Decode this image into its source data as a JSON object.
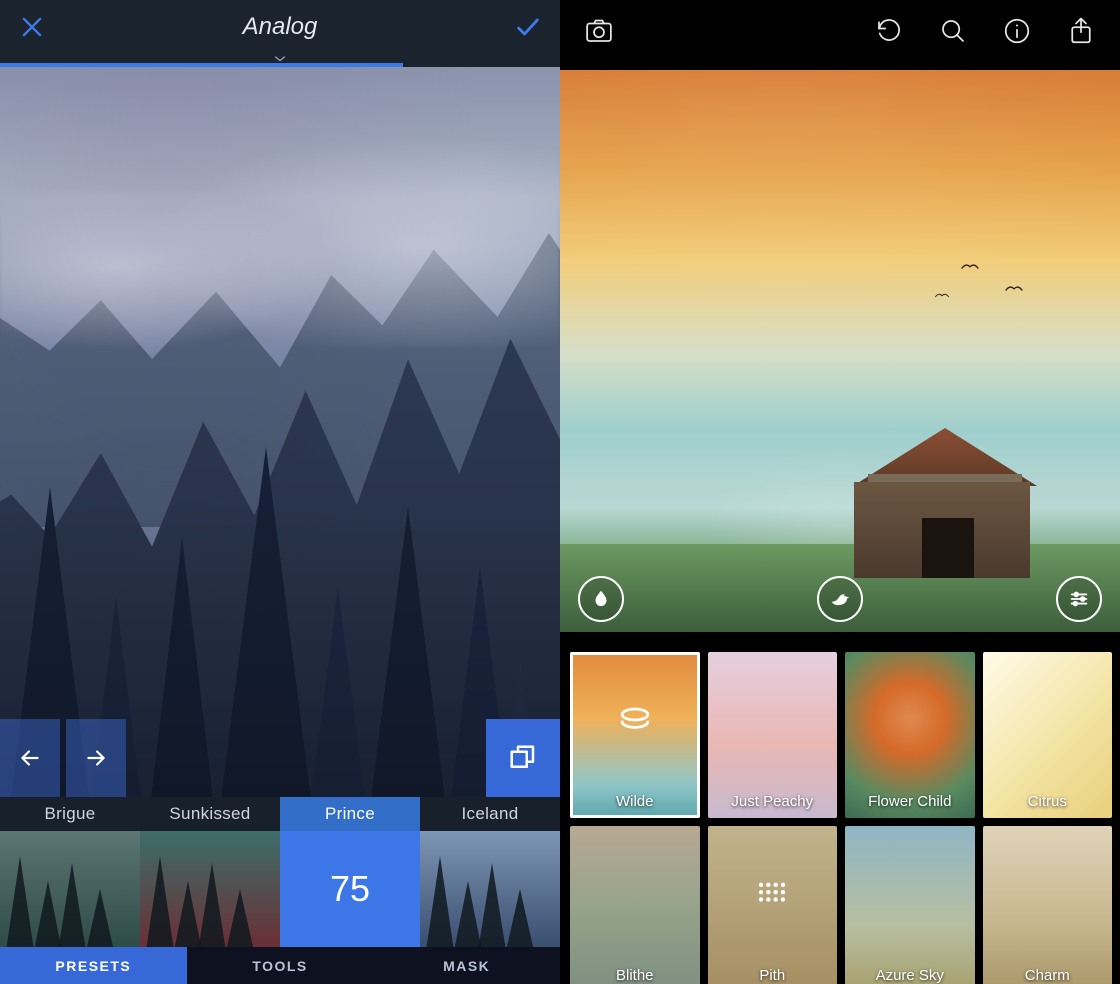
{
  "left": {
    "title": "Analog",
    "progress_percent": 72,
    "presets": {
      "items": [
        {
          "key": "brigue",
          "label": "Brigue"
        },
        {
          "key": "sunkissed",
          "label": "Sunkissed"
        },
        {
          "key": "prince",
          "label": "Prince",
          "active": true,
          "value": "75"
        },
        {
          "key": "iceland",
          "label": "Iceland"
        }
      ]
    },
    "selected_value": "75",
    "tabs": [
      {
        "label": "PRESETS",
        "active": true
      },
      {
        "label": "TOOLS",
        "active": false
      },
      {
        "label": "MASK",
        "active": false
      }
    ]
  },
  "right": {
    "overlay_icons": [
      "drop-icon",
      "bird-icon",
      "sliders-icon"
    ],
    "toolbar_icons": [
      "camera-icon",
      "undo-icon",
      "search-icon",
      "info-icon",
      "share-icon"
    ],
    "filters": [
      {
        "key": "wilde",
        "label": "Wilde",
        "glyph": "stack-icon",
        "selected": true
      },
      {
        "key": "peachy",
        "label": "Just Peachy"
      },
      {
        "key": "flowerchild",
        "label": "Flower Child"
      },
      {
        "key": "citrus",
        "label": "Citrus"
      },
      {
        "key": "blithe",
        "label": "Blithe"
      },
      {
        "key": "pith",
        "label": "Pith",
        "glyph": "dots-icon"
      },
      {
        "key": "azuresky",
        "label": "Azure Sky"
      },
      {
        "key": "charm",
        "label": "Charm"
      }
    ]
  },
  "colors": {
    "accent_blue": "#3b7be8",
    "dark_bg": "#1b232e"
  }
}
